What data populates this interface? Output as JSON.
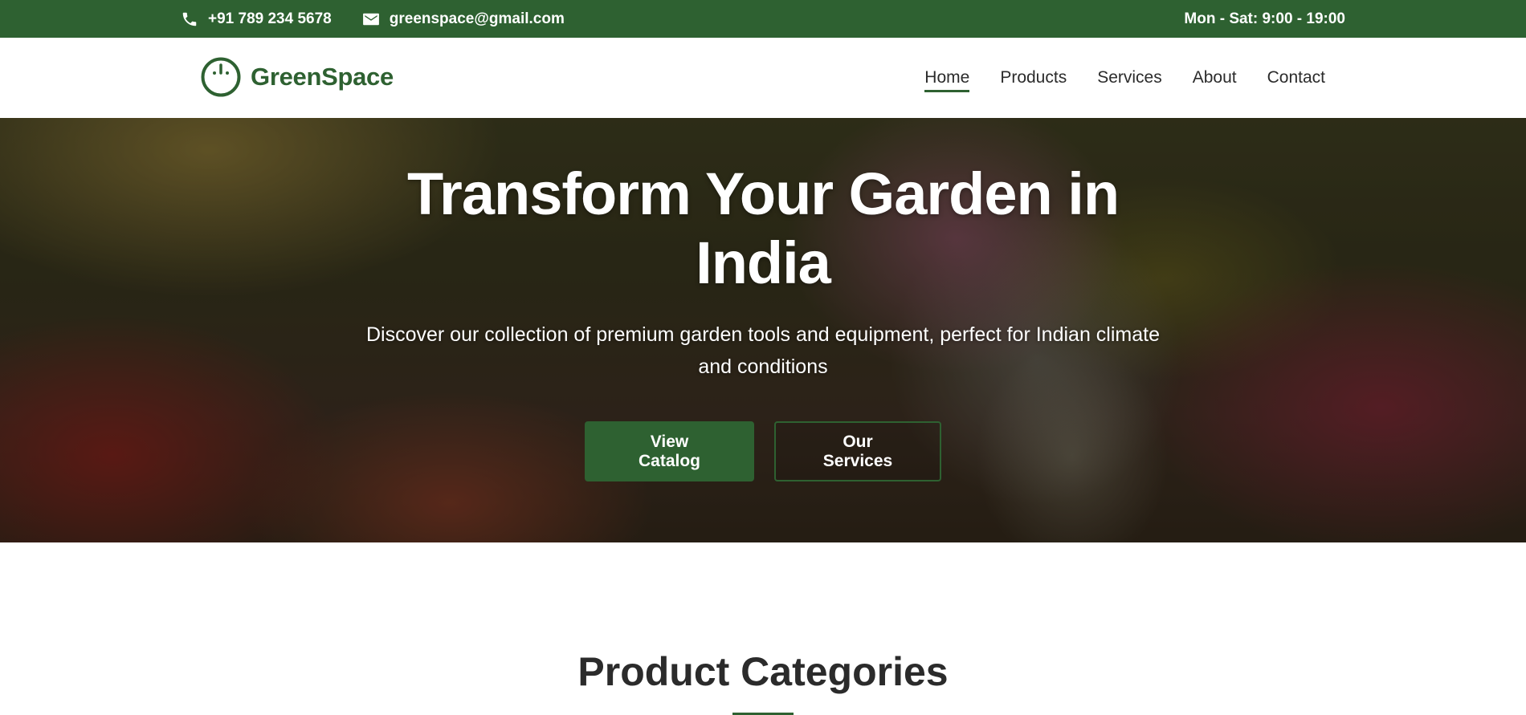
{
  "topbar": {
    "phone": "+91 789 234 5678",
    "email": "greenspace@gmail.com",
    "hours": "Mon - Sat: 9:00 - 19:00",
    "phone_icon": "phone-icon",
    "email_icon": "mail-icon"
  },
  "header": {
    "logo_text": "GreenSpace",
    "logo_icon": "power-plug-logo-icon",
    "nav": [
      {
        "label": "Home",
        "active": true
      },
      {
        "label": "Products",
        "active": false
      },
      {
        "label": "Services",
        "active": false
      },
      {
        "label": "About",
        "active": false
      },
      {
        "label": "Contact",
        "active": false
      }
    ]
  },
  "hero": {
    "title": "Transform Your Garden in India",
    "subtitle": "Discover our collection of premium garden tools and equipment, perfect for Indian climate and conditions",
    "primary_button": "View Catalog",
    "secondary_button": "Our Services"
  },
  "categories": {
    "title": "Product Categories"
  },
  "colors": {
    "brand_green": "#2e6131",
    "text_dark": "#2b2b2b",
    "white": "#ffffff"
  }
}
